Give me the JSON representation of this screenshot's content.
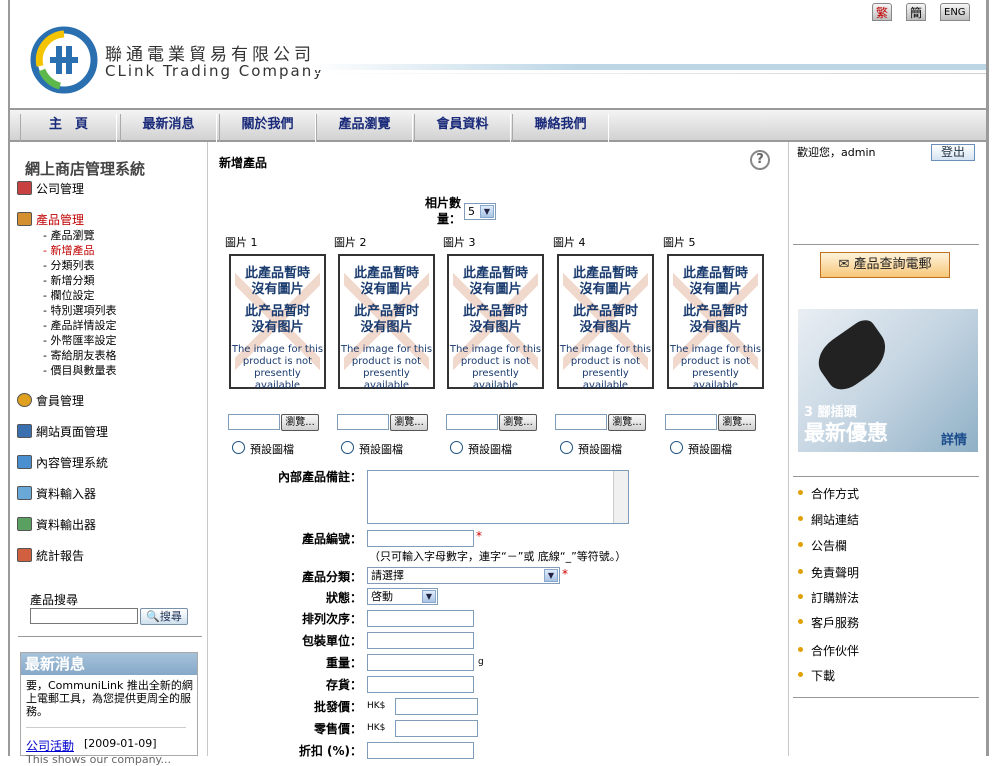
{
  "lang": {
    "tc": "繁",
    "sc": "簡",
    "en": "ENG"
  },
  "company": {
    "name_cn": "聯通電業貿易有限公司",
    "name_en": "CLink Trading Company"
  },
  "nav": [
    "主　頁",
    "最新消息",
    "關於我們",
    "產品瀏覽",
    "會員資料",
    "聯絡我們"
  ],
  "sidebar": {
    "title": "網上商店管理系統",
    "menu": [
      {
        "label": "公司管理",
        "color": "#000000"
      },
      {
        "label": "產品管理",
        "color": "#c00000"
      },
      {
        "label": "會員管理",
        "color": "#000000"
      },
      {
        "label": "網站頁面管理",
        "color": "#000000"
      },
      {
        "label": "內容管理系統",
        "color": "#000000"
      },
      {
        "label": "資料輸入器",
        "color": "#000000"
      },
      {
        "label": "資料輸出器",
        "color": "#000000"
      },
      {
        "label": "統計報告",
        "color": "#000000"
      }
    ],
    "product_sub": [
      "- 產品瀏覽",
      "- 新增產品",
      "- 分類列表",
      "- 新增分類",
      "- 欄位設定",
      "- 特別選項列表",
      "- 產品詳情設定",
      "- 外幣匯率設定",
      "- 寄給朋友表格",
      "- 價目與數量表"
    ],
    "active_sub": 1,
    "search": {
      "label": "產品搜尋",
      "button": "搜尋"
    },
    "news": {
      "heading": "最新消息",
      "body": "要，CommuniLink 推出全新的網上電郵工具，為您提供更周全的服務。",
      "link": "公司活動",
      "date": "[2009-01-09]",
      "more": "This shows our company..."
    }
  },
  "main": {
    "title": "新增產品",
    "help": "?",
    "qty_label": "相片數量：",
    "qty_value": "5",
    "images": [
      {
        "label": "圖片 1"
      },
      {
        "label": "圖片 2"
      },
      {
        "label": "圖片 3"
      },
      {
        "label": "圖片 4"
      },
      {
        "label": "圖片 5"
      }
    ],
    "placeholder": {
      "line1": "此產品暫時\n沒有圖片",
      "line2": "此产品暂时\n没有图片",
      "line3": "The image for this product is not presently available"
    },
    "browse_label": "瀏覽...",
    "default_label": "預設圖檔",
    "fields": {
      "memo": "內部產品備註：",
      "code": "產品編號：",
      "code_note": "（只可輸入字母數字，連字“－”或 底線“_”等符號。）",
      "category": "產品分類：",
      "category_value": "請選擇",
      "status": "狀態：",
      "status_value": "啓動",
      "order": "排列次序：",
      "unit": "包裝單位：",
      "weight": "重量：",
      "weight_unit": "g",
      "stock": "存貨：",
      "wholesale": "批發價：",
      "retail": "零售價：",
      "currency": "HK$",
      "discount": "折扣 (%)："
    },
    "required_mark": "*"
  },
  "right": {
    "welcome": "歡迎您，admin",
    "logout": "登出",
    "enquiry": "產品查詢電郵",
    "promo": {
      "line1": "3 腳插頭",
      "line2": "最新優惠",
      "detail": "詳情"
    },
    "links": [
      "合作方式",
      "網站連結",
      "公告欄",
      "免責聲明",
      "訂購辦法",
      "客戶服務",
      "合作伙伴",
      "下載"
    ]
  }
}
